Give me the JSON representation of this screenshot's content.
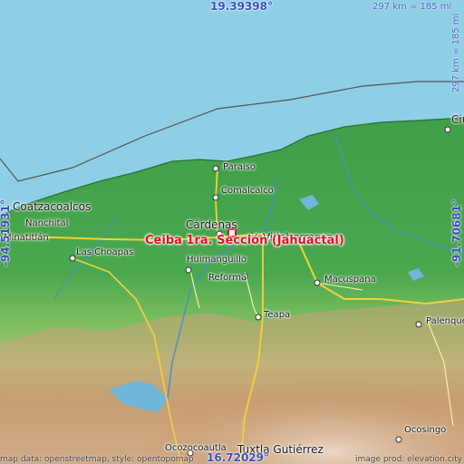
{
  "map": {
    "title_location": "Ceiba 1ra. Sección (Jahuactal)",
    "coords": {
      "top": "19.39398°",
      "bottom": "16.72029°",
      "left": "-94.51931°",
      "right": "-91.70681°"
    },
    "scale": {
      "horizontal": "297 km = 185 mi",
      "vertical": "297 km = 185 mi"
    },
    "credits": {
      "left": "map data: openstreetmap, style: opentopomap",
      "right": "image prod: elevation.city"
    },
    "cities": [
      {
        "key": "paraiso",
        "label": "Paraíso"
      },
      {
        "key": "comalcalco",
        "label": "Comalcalco"
      },
      {
        "key": "cardenas",
        "label": "Cárdenas"
      },
      {
        "key": "villahermosa",
        "label": "Villahermosa"
      },
      {
        "key": "coatzacoalcos",
        "label": "Coatzacoalcos"
      },
      {
        "key": "nanchital",
        "label": "Nanchital"
      },
      {
        "key": "minatitlan",
        "label": "Minatitlán"
      },
      {
        "key": "las_choapas",
        "label": "Las Choapas"
      },
      {
        "key": "huimanguillo",
        "label": "Huimanguillo"
      },
      {
        "key": "reforma",
        "label": "Reforma"
      },
      {
        "key": "macuspana",
        "label": "Macuspana"
      },
      {
        "key": "teapa",
        "label": "Teapa"
      },
      {
        "key": "palenque",
        "label": "Palenque"
      },
      {
        "key": "ocosingo",
        "label": "Ocosingo"
      },
      {
        "key": "ocozocoautla",
        "label": "Ocozocoautla"
      },
      {
        "key": "tuxtla",
        "label": "Tuxtla Gutiérrez"
      },
      {
        "key": "ciudad",
        "label": "Ciu"
      }
    ],
    "colors": {
      "sea": "#8fcfe6",
      "lowland": "#3ea04a",
      "hills": "#8cc36a",
      "mountains": "#c9a27a",
      "peaks": "#e8d8c8",
      "highlight": "#e0151f",
      "coord_text": "#3b4fc0"
    }
  }
}
